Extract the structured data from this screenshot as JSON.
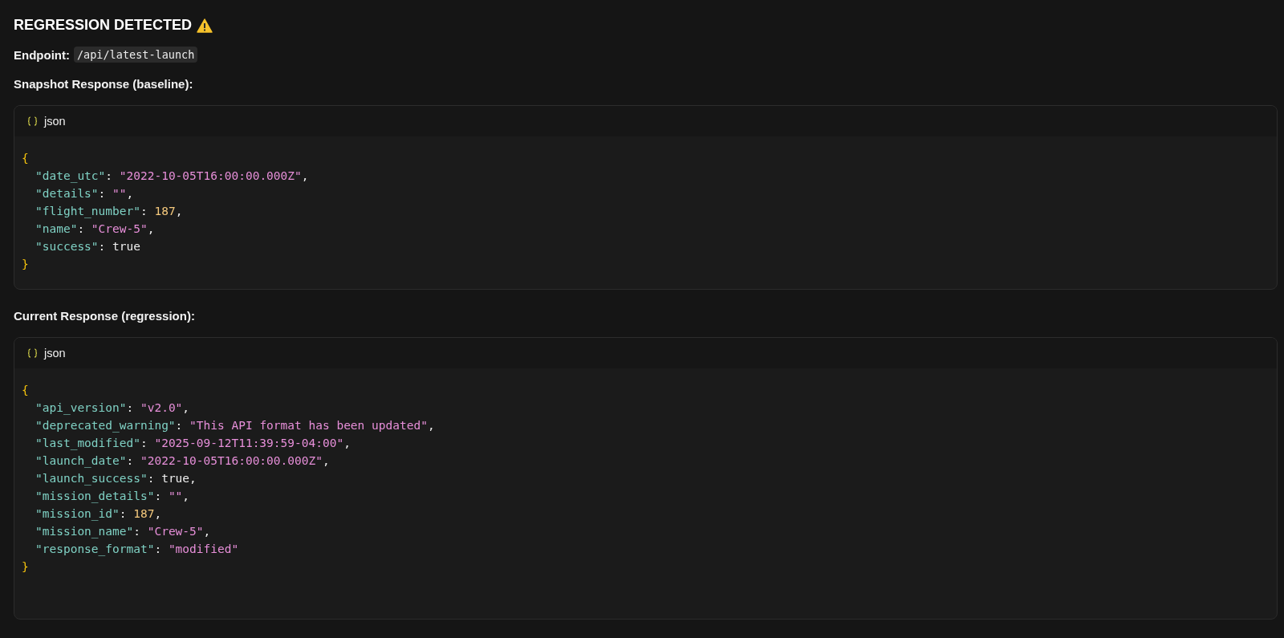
{
  "title": "REGRESSION DETECTED",
  "endpoint": {
    "label": "Endpoint:",
    "path": "/api/latest-launch"
  },
  "sections": [
    {
      "heading": "Snapshot Response (baseline):",
      "language": "json",
      "lines": [
        {
          "indented": false,
          "tokens": [
            {
              "kind": "brace",
              "text": "{"
            }
          ]
        },
        {
          "indented": true,
          "tokens": [
            {
              "kind": "key",
              "text": "\"date_utc\""
            },
            {
              "kind": "punct",
              "text": ": "
            },
            {
              "kind": "string",
              "text": "\"2022-10-05T16:00:00.000Z\""
            },
            {
              "kind": "punct",
              "text": ","
            }
          ]
        },
        {
          "indented": true,
          "tokens": [
            {
              "kind": "key",
              "text": "\"details\""
            },
            {
              "kind": "punct",
              "text": ": "
            },
            {
              "kind": "string",
              "text": "\"\""
            },
            {
              "kind": "punct",
              "text": ","
            }
          ]
        },
        {
          "indented": true,
          "tokens": [
            {
              "kind": "key",
              "text": "\"flight_number\""
            },
            {
              "kind": "punct",
              "text": ": "
            },
            {
              "kind": "number",
              "text": "187"
            },
            {
              "kind": "punct",
              "text": ","
            }
          ]
        },
        {
          "indented": true,
          "tokens": [
            {
              "kind": "key",
              "text": "\"name\""
            },
            {
              "kind": "punct",
              "text": ": "
            },
            {
              "kind": "string",
              "text": "\"Crew-5\""
            },
            {
              "kind": "punct",
              "text": ","
            }
          ]
        },
        {
          "indented": true,
          "tokens": [
            {
              "kind": "key",
              "text": "\"success\""
            },
            {
              "kind": "punct",
              "text": ": true"
            }
          ]
        },
        {
          "indented": false,
          "tokens": [
            {
              "kind": "brace",
              "text": "}"
            }
          ]
        }
      ]
    },
    {
      "heading": "Current Response (regression):",
      "language": "json",
      "lines": [
        {
          "indented": false,
          "tokens": [
            {
              "kind": "brace",
              "text": "{"
            }
          ]
        },
        {
          "indented": true,
          "tokens": [
            {
              "kind": "key",
              "text": "\"api_version\""
            },
            {
              "kind": "punct",
              "text": ": "
            },
            {
              "kind": "string",
              "text": "\"v2.0\""
            },
            {
              "kind": "punct",
              "text": ","
            }
          ]
        },
        {
          "indented": true,
          "tokens": [
            {
              "kind": "key",
              "text": "\"deprecated_warning\""
            },
            {
              "kind": "punct",
              "text": ": "
            },
            {
              "kind": "string",
              "text": "\"This API format has been updated\""
            },
            {
              "kind": "punct",
              "text": ","
            }
          ]
        },
        {
          "indented": true,
          "tokens": [
            {
              "kind": "key",
              "text": "\"last_modified\""
            },
            {
              "kind": "punct",
              "text": ": "
            },
            {
              "kind": "string",
              "text": "\"2025-09-12T11:39:59-04:00\""
            },
            {
              "kind": "punct",
              "text": ","
            }
          ]
        },
        {
          "indented": true,
          "tokens": [
            {
              "kind": "key",
              "text": "\"launch_date\""
            },
            {
              "kind": "punct",
              "text": ": "
            },
            {
              "kind": "string",
              "text": "\"2022-10-05T16:00:00.000Z\""
            },
            {
              "kind": "punct",
              "text": ","
            }
          ]
        },
        {
          "indented": true,
          "tokens": [
            {
              "kind": "key",
              "text": "\"launch_success\""
            },
            {
              "kind": "punct",
              "text": ": true,"
            }
          ]
        },
        {
          "indented": true,
          "tokens": [
            {
              "kind": "key",
              "text": "\"mission_details\""
            },
            {
              "kind": "punct",
              "text": ": "
            },
            {
              "kind": "string",
              "text": "\"\""
            },
            {
              "kind": "punct",
              "text": ","
            }
          ]
        },
        {
          "indented": true,
          "tokens": [
            {
              "kind": "key",
              "text": "\"mission_id\""
            },
            {
              "kind": "punct",
              "text": ": "
            },
            {
              "kind": "number",
              "text": "187"
            },
            {
              "kind": "punct",
              "text": ","
            }
          ]
        },
        {
          "indented": true,
          "tokens": [
            {
              "kind": "key",
              "text": "\"mission_name\""
            },
            {
              "kind": "punct",
              "text": ": "
            },
            {
              "kind": "string",
              "text": "\"Crew-5\""
            },
            {
              "kind": "punct",
              "text": ","
            }
          ]
        },
        {
          "indented": true,
          "tokens": [
            {
              "kind": "key",
              "text": "\"response_format\""
            },
            {
              "kind": "punct",
              "text": ": "
            },
            {
              "kind": "string",
              "text": "\"modified\""
            }
          ]
        },
        {
          "indented": false,
          "tokens": [
            {
              "kind": "brace",
              "text": "}"
            }
          ]
        }
      ]
    }
  ]
}
